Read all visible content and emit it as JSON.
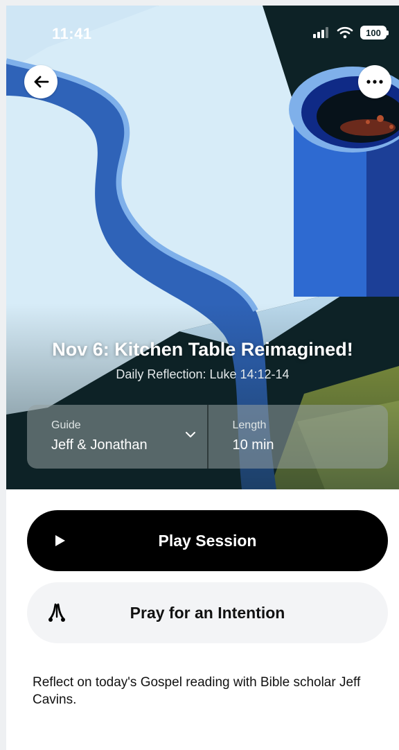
{
  "status_bar": {
    "time": "11:41",
    "battery": "100"
  },
  "nav": {
    "back_icon": "arrow-left-icon",
    "more_icon": "ellipsis-icon"
  },
  "session": {
    "title": "Nov 6: Kitchen Table Reimagined!",
    "subtitle": "Daily Reflection: Luke 14:12-14",
    "guide_label": "Guide",
    "guide_value": "Jeff & Jonathan",
    "length_label": "Length",
    "length_value": "10 min"
  },
  "actions": {
    "play_label": "Play Session",
    "pray_label": "Pray for an Intention"
  },
  "description": "Reflect on today's Gospel reading with Bible scholar Jeff Cavins.",
  "colors": {
    "hero_bg": "#0d2226",
    "paper": "#dbeef9",
    "stripe_blue": "#2f63b8",
    "cup_blue": "#2e6ad1",
    "accent_green": "#c9db6a",
    "button_dark": "#000000",
    "button_light": "#f3f4f6"
  }
}
